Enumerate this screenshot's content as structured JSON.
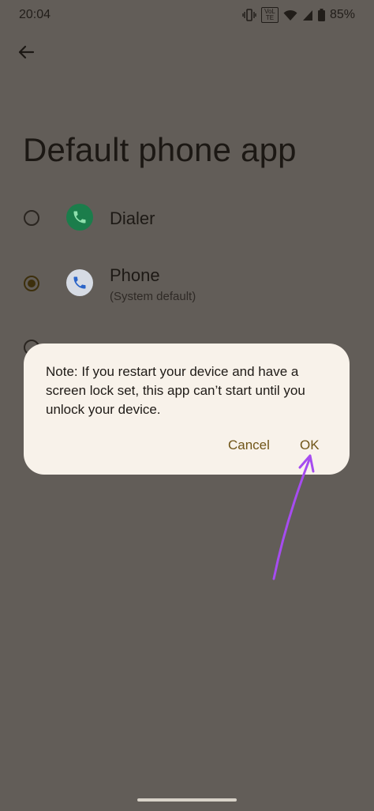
{
  "status_bar": {
    "time": "20:04",
    "battery": "85%",
    "volte_label": "VoLTE",
    "icons": [
      "vibrate-icon",
      "volte-icon",
      "wifi-icon",
      "signal-icon",
      "battery-icon"
    ]
  },
  "header": {
    "back_icon": "arrow-back-icon",
    "title": "Default phone app"
  },
  "options": [
    {
      "label": "Dialer",
      "subtitle": "",
      "selected": false,
      "icon": "dialer-app-icon",
      "icon_color": "#1b7d4b"
    },
    {
      "label": "Phone",
      "subtitle": "(System default)",
      "selected": true,
      "icon": "phone-app-icon",
      "icon_color": "#d6dbe4"
    }
  ],
  "dialog": {
    "message": "Note: If you restart your device and have a screen lock set, this app can’t start until you unlock your device.",
    "cancel_label": "Cancel",
    "ok_label": "OK"
  },
  "colors": {
    "scrim_background": "#625d58",
    "dialog_background": "#f8f2ea",
    "accent": "#705518",
    "annotation_arrow": "#a64cf0"
  }
}
